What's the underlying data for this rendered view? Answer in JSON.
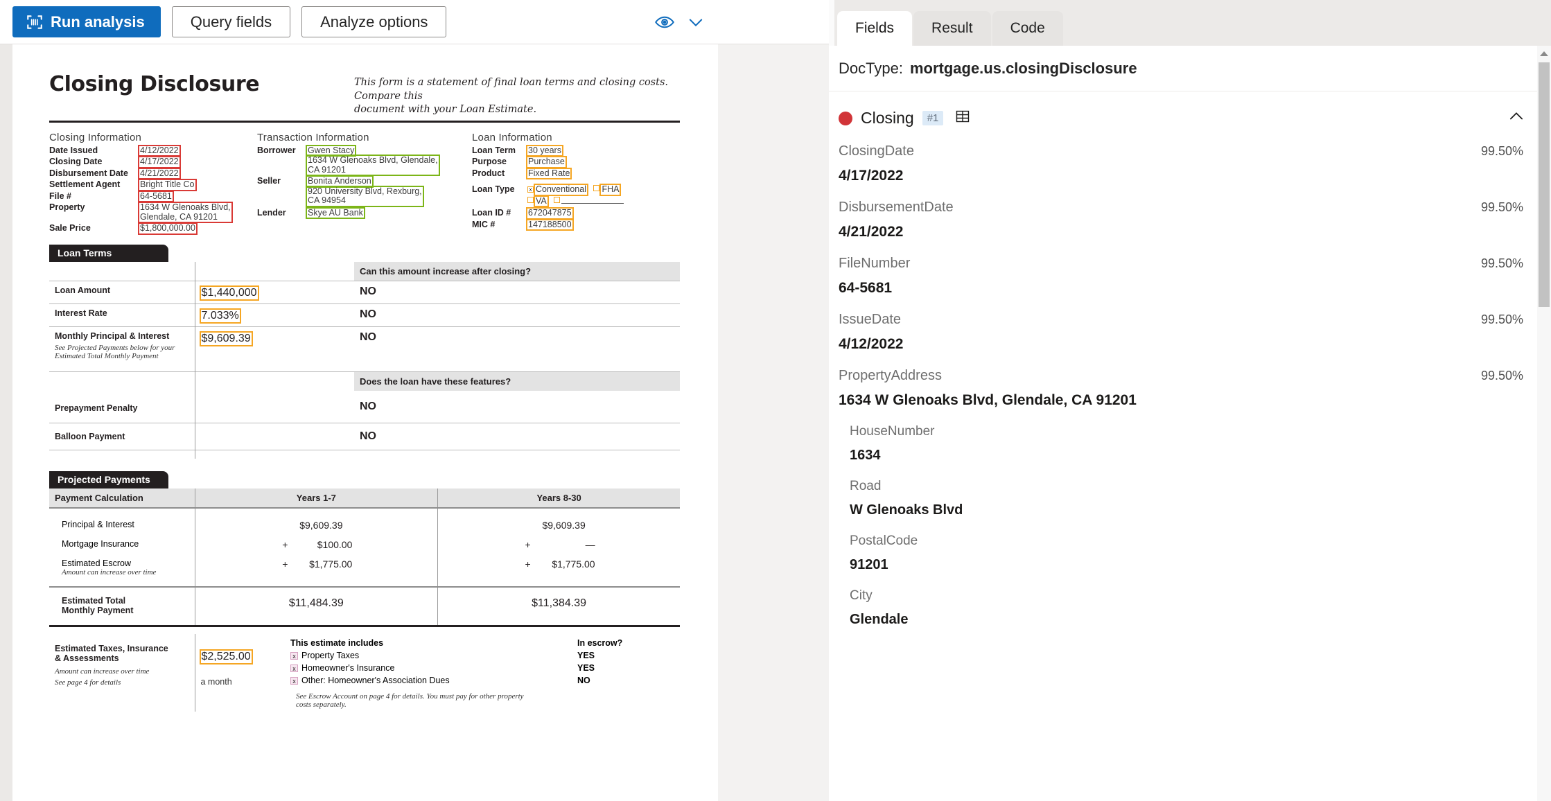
{
  "toolbar": {
    "run_analysis_label": "Run analysis",
    "query_fields_label": "Query fields",
    "analyze_options_label": "Analyze options",
    "eye_icon": "eye-icon",
    "chevron_icon": "chevron-down-icon",
    "accent_color": "#0f6cbd"
  },
  "panel": {
    "tabs": [
      {
        "label": "Fields",
        "active": true
      },
      {
        "label": "Result",
        "active": false
      },
      {
        "label": "Code",
        "active": false
      }
    ],
    "doctype_label": "DocType:",
    "doctype_value": "mortgage.us.closingDisclosure",
    "group": {
      "name": "Closing",
      "badge": "#1",
      "status_color": "#d13438",
      "table_icon": "table-grid-icon",
      "collapse_icon": "chevron-up-icon"
    },
    "fields": [
      {
        "label": "ClosingDate",
        "confidence": "99.50%",
        "value": "4/17/2022",
        "nested": false
      },
      {
        "label": "DisbursementDate",
        "confidence": "99.50%",
        "value": "4/21/2022",
        "nested": false
      },
      {
        "label": "FileNumber",
        "confidence": "99.50%",
        "value": "64-5681",
        "nested": false
      },
      {
        "label": "IssueDate",
        "confidence": "99.50%",
        "value": "4/12/2022",
        "nested": false
      },
      {
        "label": "PropertyAddress",
        "confidence": "99.50%",
        "value": "1634 W Glenoaks Blvd, Glendale, CA 91201",
        "nested": false
      },
      {
        "label": "HouseNumber",
        "confidence": "",
        "value": "1634",
        "nested": true
      },
      {
        "label": "Road",
        "confidence": "",
        "value": "W Glenoaks Blvd",
        "nested": true
      },
      {
        "label": "PostalCode",
        "confidence": "",
        "value": "91201",
        "nested": true
      },
      {
        "label": "City",
        "confidence": "",
        "value": "Glendale",
        "nested": true
      }
    ]
  },
  "document": {
    "title": "Closing Disclosure",
    "subtitle_line1": "This form is a statement of final loan terms and closing costs. Compare this",
    "subtitle_line2": "document with your Loan Estimate.",
    "closing_info": {
      "heading": "Closing Information",
      "rows": [
        {
          "key": "Date Issued",
          "value": "4/12/2022"
        },
        {
          "key": "Closing Date",
          "value": "4/17/2022"
        },
        {
          "key": "Disbursement Date",
          "value": "4/21/2022"
        },
        {
          "key": "Settlement Agent",
          "value": "Bright  Title Co"
        },
        {
          "key": "File #",
          "value": "64-5681"
        },
        {
          "key": "Property",
          "value": "1634 W Glenoaks Blvd,"
        },
        {
          "key": "",
          "value": "Glendale, CA 91201"
        },
        {
          "key": "Sale Price",
          "value": "$1,800,000.00"
        }
      ]
    },
    "transaction_info": {
      "heading": "Transaction  Information",
      "borrower_label": "Borrower",
      "borrower_name": "Gwen Stacy",
      "borrower_addr1": "1634 W Glenoaks Blvd, Glendale,",
      "borrower_addr2": "CA 91201",
      "seller_label": "Seller",
      "seller_name": "Bonita Anderson",
      "seller_addr1": "920 University Blvd, Rexburg,",
      "seller_addr2": "CA 94954",
      "lender_label": "Lender",
      "lender_name": "Skye AU Bank"
    },
    "loan_info": {
      "heading": "Loan  Information",
      "term_label": "Loan Term",
      "term_value": "30 years",
      "purpose_label": "Purpose",
      "purpose_value": "Purchase",
      "product_label": "Product",
      "product_value": "Fixed Rate",
      "type_label": "Loan Type",
      "type_conventional": "Conventional",
      "type_conventional_mark": "x",
      "type_fha": "FHA",
      "type_va": "VA",
      "type_other": "",
      "loan_id_label": "Loan ID #",
      "loan_id_value": "672047875",
      "mic_label": "MIC #",
      "mic_value": "147188500"
    },
    "loan_terms": {
      "tab": "Loan Terms",
      "col_header": "Can this amount increase after closing?",
      "features_header": "Does the loan have these features?",
      "rows": [
        {
          "label": "Loan Amount",
          "note": "",
          "amount": "$1,440,000",
          "answer": "NO",
          "highlight": true
        },
        {
          "label": "Interest Rate",
          "note": "",
          "amount": "7.033%",
          "answer": "NO",
          "highlight": true
        },
        {
          "label": "Monthly Principal & Interest",
          "note": "See Projected Payments below for your\nEstimated Total Monthly Payment",
          "amount": "$9,609.39",
          "answer": "NO",
          "highlight": true
        }
      ],
      "features": [
        {
          "label": "Prepayment Penalty",
          "answer": "NO"
        },
        {
          "label": "Balloon Payment",
          "answer": "NO"
        }
      ]
    },
    "projected_payments": {
      "tab": "Projected Payments",
      "col_calc": "Payment Calculation",
      "col_y1": "Years 1-7",
      "col_y2": "Years 8-30",
      "rows": [
        {
          "label": "Principal & Interest",
          "note": "",
          "sign1": "",
          "v1": "$9,609.39",
          "sign2": "",
          "v2": "$9,609.39"
        },
        {
          "label": "Mortgage Insurance",
          "note": "",
          "sign1": "+",
          "v1": "$100.00",
          "sign2": "+",
          "v2": "—"
        },
        {
          "label": "Estimated Escrow",
          "note": "Amount can increase over time",
          "sign1": "+",
          "v1": "$1,775.00",
          "sign2": "+",
          "v2": "$1,775.00"
        }
      ],
      "total_label_line1": "Estimated Total",
      "total_label_line2": "Monthly Payment",
      "total_y1": "$11,484.39",
      "total_y2": "$11,384.39"
    },
    "escrow": {
      "label_line1": "Estimated Taxes, Insurance",
      "label_line2": "& Assessments",
      "note1": "Amount can increase over time",
      "note2": "See page 4 for details",
      "amount": "$2,525.00",
      "amount_note": "a month",
      "includes_header": "This estimate includes",
      "escrow_header": "In escrow?",
      "items": [
        {
          "mark": "x",
          "label": "Property Taxes",
          "escrow": "YES"
        },
        {
          "mark": "x",
          "label": "Homeowner's Insurance",
          "escrow": "YES"
        },
        {
          "mark": "x",
          "label": "Other: Homeowner's Association Dues",
          "escrow": "NO"
        }
      ],
      "footnote1": "See Escrow Account on page 4 for details. You must pay for other property",
      "footnote2": "costs separately."
    }
  }
}
